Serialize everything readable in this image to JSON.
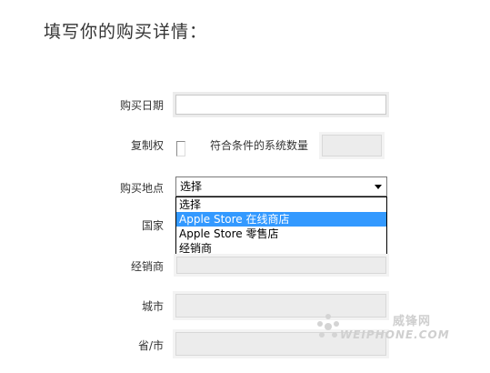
{
  "page": {
    "title": "填写你的购买详情："
  },
  "form": {
    "purchase_date": {
      "label": "购买日期",
      "value": ""
    },
    "copy_right": {
      "label": "复制权",
      "checked": false
    },
    "eligible_count": {
      "label": "符合条件的系统数量",
      "value": ""
    },
    "purchase_location": {
      "label": "购买地点",
      "selected": "选择",
      "options": [
        "选择",
        "Apple Store 在线商店",
        "Apple Store 零售店",
        "经销商"
      ],
      "highlighted": "Apple Store 在线商店"
    },
    "country": {
      "label": "国家",
      "value": ""
    },
    "dealer": {
      "label": "经销商",
      "value": ""
    },
    "city": {
      "label": "城市",
      "value": ""
    },
    "province_city": {
      "label": "省/市",
      "value": ""
    }
  },
  "watermark": {
    "brand_cn": "威锋网",
    "brand_en": "WEIPHONE.COM",
    "icon": "weiphone-logo-icon",
    "color": "#cfcfcf"
  },
  "colors": {
    "highlight": "#3399ff",
    "field_bg": "#f0f0f0"
  }
}
